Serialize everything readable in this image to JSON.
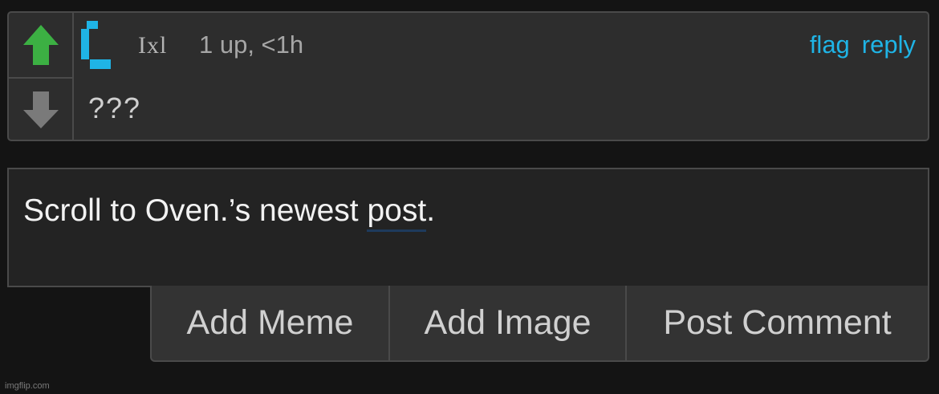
{
  "comment": {
    "username": "Ixl",
    "meta": "1 up, <1h",
    "actions": {
      "flag": "flag",
      "reply": "reply"
    },
    "text": "???",
    "upvote_icon": "arrow-up-icon",
    "downvote_icon": "arrow-down-icon",
    "upvote_color": "#3cb043",
    "downvote_color": "#7a7a7a",
    "avatar_color": "#1fb4e6"
  },
  "composer": {
    "text_before": "Scroll to Oven.’s newest ",
    "text_misspelled": "post",
    "text_after": "."
  },
  "buttons": {
    "add_meme": "Add Meme",
    "add_image": "Add Image",
    "post_comment": "Post Comment"
  },
  "watermark": "imgflip.com",
  "colors": {
    "link": "#1fb4e6",
    "background": "#141414",
    "panel": "#2d2d2d"
  }
}
